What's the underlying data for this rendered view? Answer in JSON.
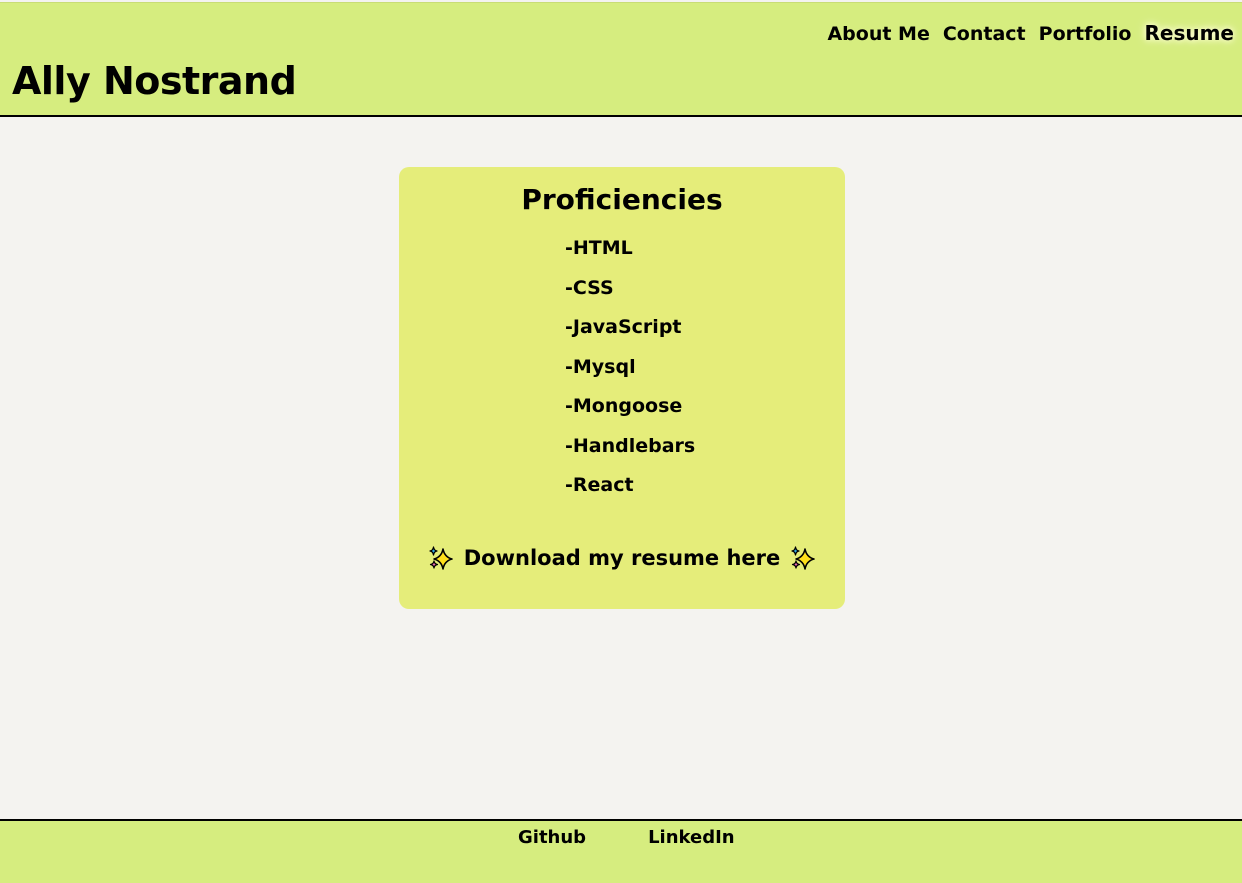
{
  "header": {
    "site_title": "Ally Nostrand",
    "nav": [
      {
        "label": "About Me"
      },
      {
        "label": "Contact"
      },
      {
        "label": "Portfolio"
      },
      {
        "label": "Resume",
        "active": true
      }
    ],
    "background_color": "#d6ed7f"
  },
  "card": {
    "title": "Proficiencies",
    "skills": [
      "-HTML",
      "-CSS",
      "-JavaScript",
      "-Mysql",
      "-Mongoose",
      "-Handlebars",
      "-React"
    ],
    "download_label": "Download my resume here",
    "download_icon": "sparkles-icon",
    "background_color": "#e5ed7a"
  },
  "footer": {
    "links": [
      "Github",
      "LinkedIn"
    ]
  },
  "colors": {
    "page_background": "#f4f3f0",
    "accent": "#d6ed7f"
  }
}
